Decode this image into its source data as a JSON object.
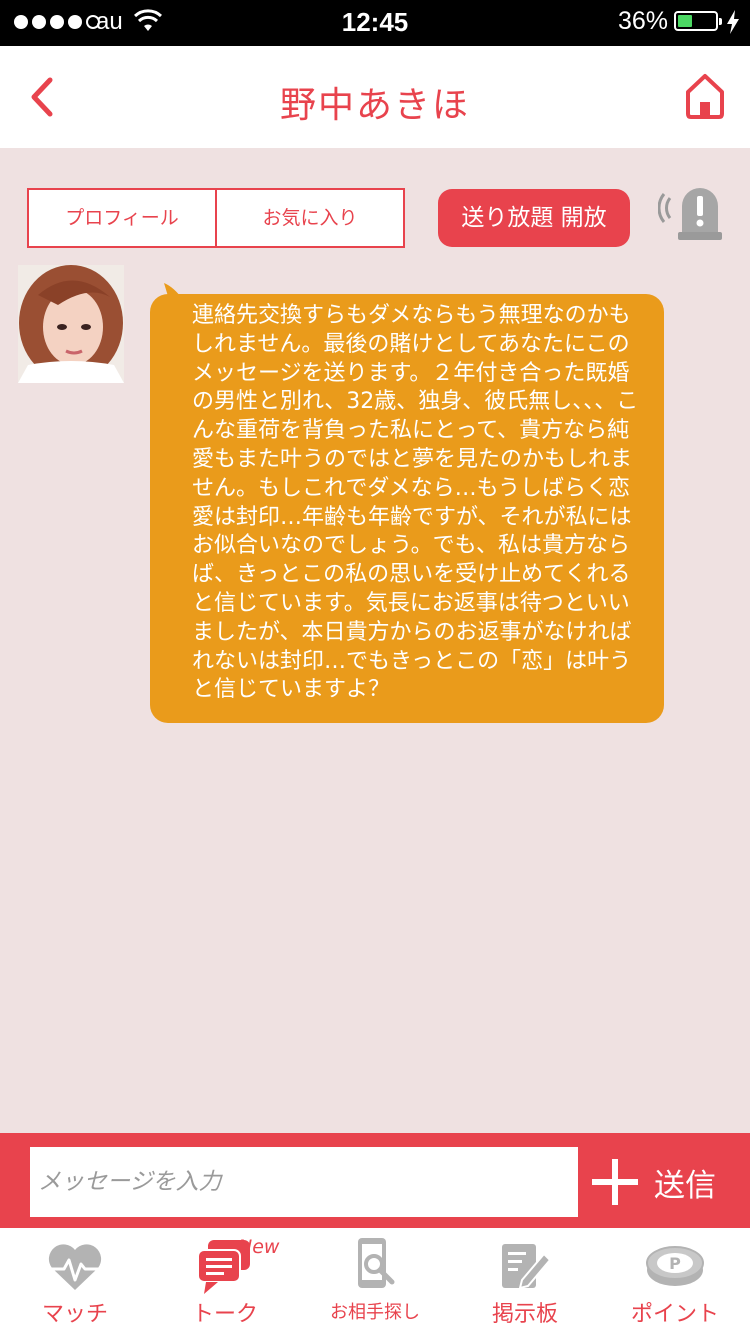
{
  "status_bar": {
    "carrier": "au",
    "time": "12:45",
    "battery_percent": "36%",
    "battery_level": 0.36
  },
  "nav": {
    "title": "野中あきほ"
  },
  "actions": {
    "profile_label": "プロフィール",
    "favorite_label": "お気に入り",
    "unlimited_label": "送り放題 開放"
  },
  "message": {
    "text": "連絡先交換すらもダメならもう無理なのかもしれません。最後の賭けとしてあなたにこのメッセージを送ります。２年付き合った既婚の男性と別れ、32歳、独身、彼氏無し、、、こんな重荷を背負った私にとって、貴方なら純愛もまた叶うのではと夢を見たのかもしれません。もしこれでダメなら…もうしばらく恋愛は封印…年齢も年齢ですが、それが私にはお似合いなのでしょう。でも、私は貴方ならば、きっとこの私の思いを受け止めてくれると信じています。気長にお返事は待つといいましたが、本日貴方からのお返事がなければれないは封印…でもきっとこの「恋」は叶うと信じていますよ？"
  },
  "input": {
    "placeholder": "メッセージを入力",
    "send_label": "送信"
  },
  "tabs": [
    {
      "label": "マッチ",
      "icon": "heart-pulse-icon"
    },
    {
      "label": "トーク",
      "icon": "chat-icon",
      "badge": "New"
    },
    {
      "label": "お相手探し",
      "icon": "phone-search-icon"
    },
    {
      "label": "掲示板",
      "icon": "board-edit-icon"
    },
    {
      "label": "ポイント",
      "icon": "point-coin-icon"
    }
  ],
  "colors": {
    "accent": "#e8434d",
    "bubble": "#ea9b1b",
    "background": "#efe1e1",
    "inactive_icon": "#b3b3b3"
  }
}
